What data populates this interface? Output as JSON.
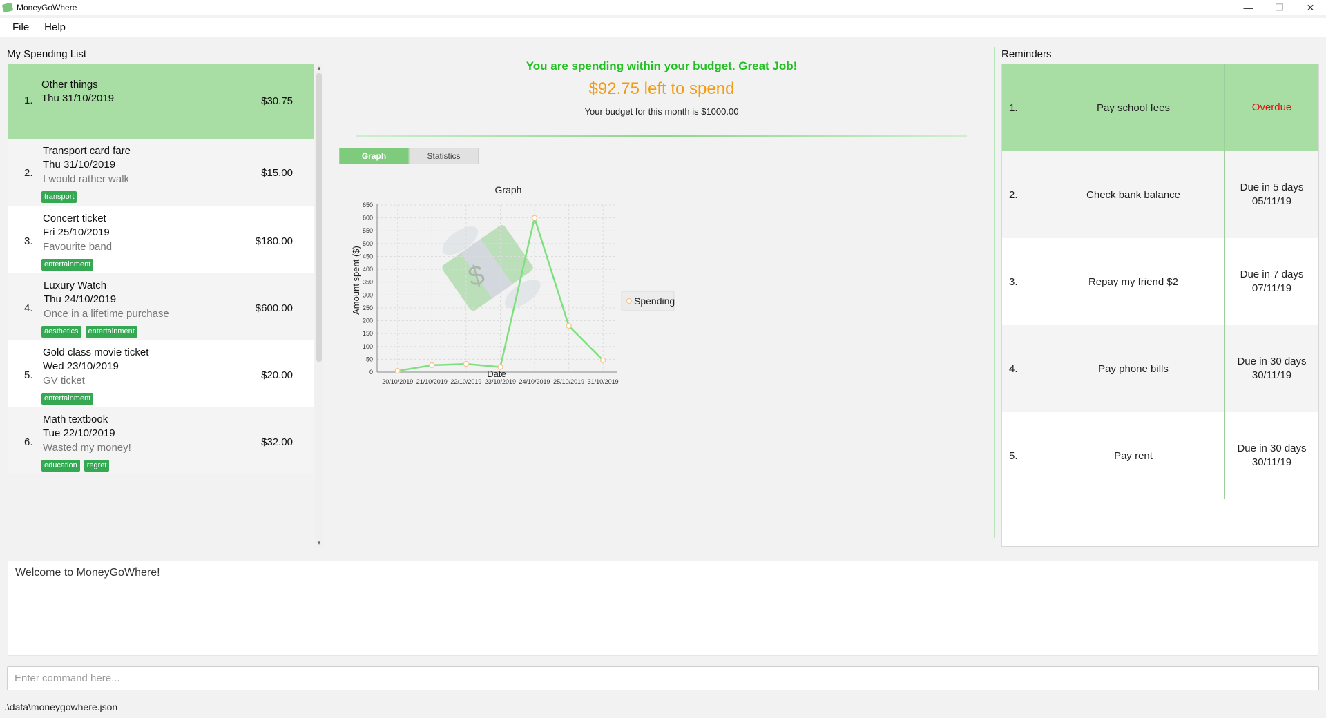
{
  "window": {
    "title": "MoneyGoWhere",
    "minimize": "—",
    "restore": "❐",
    "close": "✕"
  },
  "menu": {
    "file": "File",
    "help": "Help"
  },
  "spending": {
    "title": "My Spending List",
    "items": [
      {
        "index": "1.",
        "title": "Other things",
        "date": "Thu 31/10/2019",
        "remark": "",
        "amount": "$30.75",
        "tags": []
      },
      {
        "index": "2.",
        "title": "Transport card fare",
        "date": "Thu 31/10/2019",
        "remark": "I would rather walk",
        "amount": "$15.00",
        "tags": [
          "transport"
        ]
      },
      {
        "index": "3.",
        "title": "Concert ticket",
        "date": "Fri 25/10/2019",
        "remark": "Favourite band",
        "amount": "$180.00",
        "tags": [
          "entertainment"
        ]
      },
      {
        "index": "4.",
        "title": "Luxury Watch",
        "date": "Thu 24/10/2019",
        "remark": "Once in a lifetime purchase",
        "amount": "$600.00",
        "tags": [
          "aesthetics",
          "entertainment"
        ]
      },
      {
        "index": "5.",
        "title": "Gold class movie ticket",
        "date": "Wed 23/10/2019",
        "remark": "GV ticket",
        "amount": "$20.00",
        "tags": [
          "entertainment"
        ]
      },
      {
        "index": "6.",
        "title": "Math textbook",
        "date": "Tue 22/10/2019",
        "remark": "Wasted my money!",
        "amount": "$32.00",
        "tags": [
          "education",
          "regret"
        ]
      }
    ]
  },
  "budget": {
    "message": "You are spending within your budget. Great Job!",
    "left": "$92.75 left to spend",
    "total": "Your budget for this month is $1000.00"
  },
  "tabs": {
    "graph": "Graph",
    "statistics": "Statistics"
  },
  "chart_data": {
    "type": "line",
    "title": "Graph",
    "xlabel": "Date",
    "ylabel": "Amount spent ($)",
    "categories": [
      "20/10/2019",
      "21/10/2019",
      "22/10/2019",
      "23/10/2019",
      "24/10/2019",
      "25/10/2019",
      "31/10/2019"
    ],
    "series": [
      {
        "name": "Spending",
        "values": [
          5,
          27,
          32,
          20,
          600,
          180,
          46
        ],
        "color": "#7ee07e"
      }
    ],
    "ylim": [
      0,
      650
    ],
    "yticks": [
      0,
      50,
      100,
      150,
      200,
      250,
      300,
      350,
      400,
      450,
      500,
      550,
      600,
      650
    ],
    "grid": true,
    "legend": "right"
  },
  "reminders": {
    "title": "Reminders",
    "items": [
      {
        "index": "1.",
        "description": "Pay school fees",
        "status": "Overdue",
        "date": ""
      },
      {
        "index": "2.",
        "description": "Check bank balance",
        "status": "Due in 5 days",
        "date": "05/11/19"
      },
      {
        "index": "3.",
        "description": "Repay my friend $2",
        "status": "Due in 7 days",
        "date": "07/11/19"
      },
      {
        "index": "4.",
        "description": "Pay phone bills",
        "status": "Due in 30 days",
        "date": "30/11/19"
      },
      {
        "index": "5.",
        "description": "Pay rent",
        "status": "Due in 30 days",
        "date": "30/11/19"
      }
    ]
  },
  "result": {
    "text": "Welcome to MoneyGoWhere!"
  },
  "command": {
    "placeholder": "Enter command here...",
    "value": ""
  },
  "status": {
    "path": ".\\data\\moneygowhere.json"
  }
}
